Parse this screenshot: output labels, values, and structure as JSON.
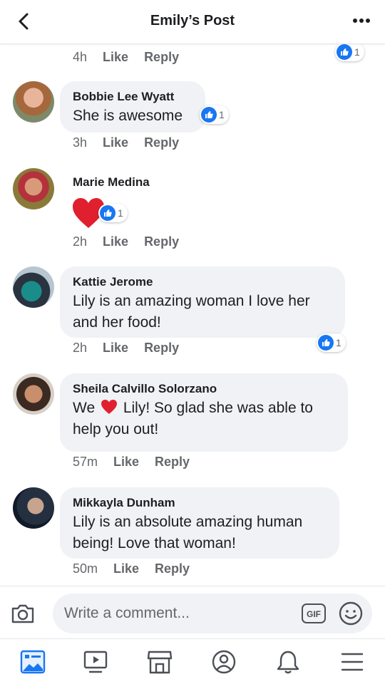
{
  "header": {
    "title": "Emily’s Post"
  },
  "actions": {
    "like": "Like",
    "reply": "Reply"
  },
  "top_comment": {
    "time": "4h",
    "reaction_count": "1"
  },
  "comments": [
    {
      "name": "Bobbie Lee Wyatt",
      "text": "She is awesome",
      "time": "3h",
      "reaction_count": "1"
    },
    {
      "name": "Marie Medina",
      "text": "",
      "time": "2h",
      "reaction_count": "1",
      "sticker": "heart"
    },
    {
      "name": "Kattie Jerome",
      "text": "Lily is an amazing woman I love her and her food!",
      "time": "2h",
      "reaction_count": "1"
    },
    {
      "name": "Sheila Calvillo Solorzano",
      "text_before": "We",
      "text_after": "Lily! So glad she was able to help you out!",
      "time": "57m"
    },
    {
      "name": "Mikkayla Dunham",
      "text": "Lily is an absolute amazing human being! Love that woman!",
      "time": "50m"
    }
  ],
  "composer": {
    "placeholder": "Write a comment...",
    "gif_label": "GIF"
  },
  "colors": {
    "accent": "#1877f2",
    "bubble": "#f0f2f5",
    "heart": "#e0202e",
    "muted": "#65676b"
  },
  "icons": [
    "back-arrow-icon",
    "more-icon",
    "camera-icon",
    "gif-icon",
    "emoji-icon",
    "news-feed-icon",
    "watch-icon",
    "marketplace-icon",
    "profile-icon",
    "notifications-icon",
    "menu-icon"
  ]
}
